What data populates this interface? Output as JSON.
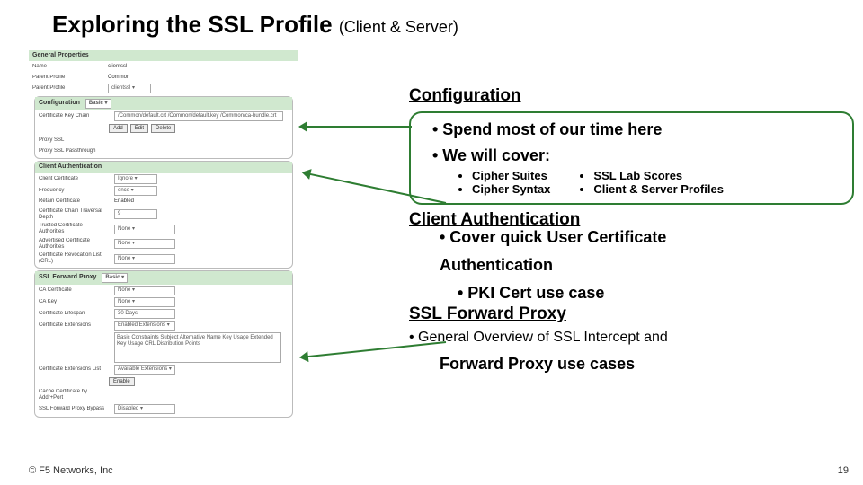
{
  "title": {
    "main": "Exploring the SSL Profile",
    "sub": "(Client & Server)"
  },
  "footer_left": "© F5 Networks, Inc",
  "footer_right": "19",
  "right": {
    "config": {
      "heading": "Configuration",
      "bullet1": "•  Spend most of our time here",
      "bullet2": "•  We will cover:",
      "sub_left": [
        "Cipher Suites",
        "Cipher Syntax"
      ],
      "sub_right": [
        "SSL Lab Scores",
        "Client & Server Profiles"
      ]
    },
    "client_auth": {
      "heading": "Client Authentication",
      "b1": "•  Cover quick User Certificate",
      "b2": "Authentication",
      "b3": "•  PKI Cert use case"
    },
    "sfp": {
      "heading": "SSL Forward Proxy",
      "b1": "•  General Overview of SSL Intercept and",
      "b2": "Forward Proxy use cases"
    }
  },
  "shot": {
    "general": {
      "head": "General Properties",
      "name_l": "Name",
      "name_v": "clientssl",
      "parent_l": "Parent Profile",
      "parent_v": "Common",
      "pp_l": "Parent Profile",
      "pp_v": "clientssl"
    },
    "config": {
      "head": "Configuration",
      "mode": "Basic",
      "ckc_l": "Certificate Key Chain",
      "ckc_v": "/Common/default.crt /Common/default.key /Common/ca-bundle.crt",
      "btn_add": "Add",
      "btn_edit": "Edit",
      "btn_del": "Delete",
      "proxy_l": "Proxy SSL",
      "proxy_v": "",
      "passth_l": "Proxy SSL Passthrough",
      "passth_v": ""
    },
    "client_auth": {
      "head": "Client Authentication",
      "cc_l": "Client Certificate",
      "cc_v": "Ignore",
      "freq_l": "Frequency",
      "freq_v": "once",
      "ra_l": "Retain Certificate",
      "ra_v": "Enabled",
      "chain_l": "Certificate Chain Traversal Depth",
      "chain_v": "9",
      "tca_l": "Trusted Certificate Authorities",
      "tca_v": "None",
      "aca_l": "Advertised Certificate Authorities",
      "aca_v": "None",
      "crl_l": "Certificate Revocation List (CRL)",
      "crl_v": "None"
    },
    "sfp": {
      "head": "SSL Forward Proxy",
      "mode": "Basic",
      "cc_l": "CA Certificate",
      "cc_v": "None",
      "ck_l": "CA Key",
      "ck_v": "None",
      "cl_l": "Certificate Lifespan",
      "cl_v": "30   Days",
      "ce_l": "Certificate Extensions",
      "ce_v": "Enabled Extensions",
      "ext_list": "Basic Constraints\nSubject Alternative Name\nKey Usage\nExtended Key Usage\nCRL Distribution Points",
      "cel_l": "Certificate Extensions List",
      "cel_v": "Available Extensions",
      "btn_enable": "Enable",
      "ccr_l": "Cache Certificate by Addr+Port",
      "ccr_v": "",
      "bp_l": "SSL Forward Proxy Bypass",
      "bp_v": "Disabled"
    }
  }
}
